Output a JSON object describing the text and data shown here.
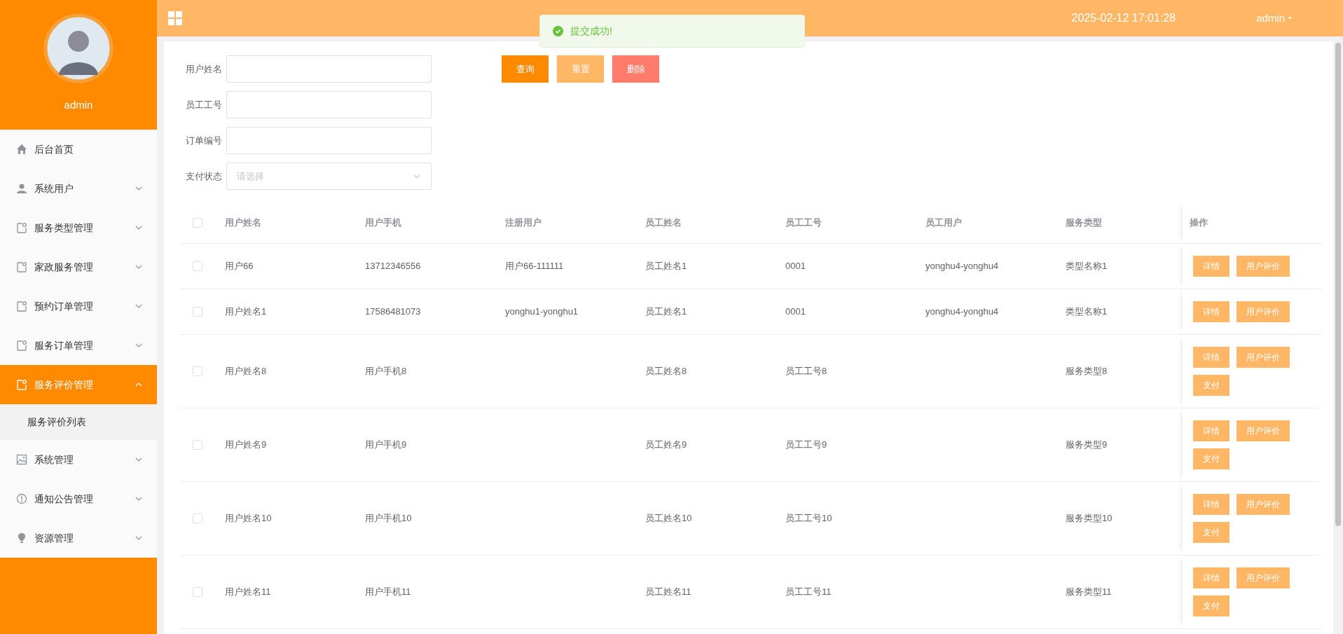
{
  "header": {
    "datetime": "2025-02-12 17:01:28",
    "user": "admin"
  },
  "toast": {
    "message": "提交成功!"
  },
  "sidebar": {
    "username": "admin",
    "items": [
      {
        "label": "后台首页",
        "kind": "home",
        "selected": false
      },
      {
        "label": "系统用户",
        "kind": "user",
        "expanded": false,
        "selected": false
      },
      {
        "label": "服务类型管理",
        "kind": "doc",
        "expanded": false,
        "selected": false
      },
      {
        "label": "家政服务管理",
        "kind": "doc",
        "expanded": false,
        "selected": false
      },
      {
        "label": "预约订单管理",
        "kind": "doc",
        "expanded": false,
        "selected": false
      },
      {
        "label": "服务订单管理",
        "kind": "doc",
        "expanded": false,
        "selected": false
      },
      {
        "label": "服务评价管理",
        "kind": "doc",
        "expanded": true,
        "selected": true,
        "children": [
          {
            "label": "服务评价列表"
          }
        ]
      },
      {
        "label": "系统管理",
        "kind": "image",
        "expanded": false,
        "selected": false
      },
      {
        "label": "通知公告管理",
        "kind": "alert",
        "expanded": false,
        "selected": false
      },
      {
        "label": "资源管理",
        "kind": "bulb",
        "expanded": false,
        "selected": false
      }
    ]
  },
  "filters": [
    {
      "label": "用户姓名",
      "kind": "text"
    },
    {
      "label": "员工工号",
      "kind": "text"
    },
    {
      "label": "订单编号",
      "kind": "text"
    },
    {
      "label": "支付状态",
      "kind": "select",
      "placeholder": "请选择"
    }
  ],
  "buttons": [
    {
      "label": "查询",
      "kind": "primary"
    },
    {
      "label": "重置",
      "kind": "secondary"
    },
    {
      "label": "删除",
      "kind": "danger"
    }
  ],
  "table": {
    "all_checked": false,
    "columns": [
      "用户姓名",
      "用户手机",
      "注册用户",
      "员工姓名",
      "员工工号",
      "员工用户",
      "服务类型",
      "操作"
    ],
    "rows": [
      {
        "checked": false,
        "cells": [
          "用户66",
          "13712346556",
          "用户66-111111",
          "员工姓名1",
          "0001",
          "yonghu4-yonghu4",
          "类型名称1"
        ],
        "actions": [
          "详情",
          "用户评价"
        ]
      },
      {
        "checked": false,
        "cells": [
          "用户姓名1",
          "17586481073",
          "yonghu1-yonghu1",
          "员工姓名1",
          "0001",
          "yonghu4-yonghu4",
          "类型名称1"
        ],
        "actions": [
          "详情",
          "用户评价"
        ]
      },
      {
        "checked": false,
        "cells": [
          "用户姓名8",
          "用户手机8",
          null,
          "员工姓名8",
          "员工工号8",
          null,
          "服务类型8"
        ],
        "actions": [
          "详情",
          "用户评价",
          "支付"
        ]
      },
      {
        "checked": false,
        "cells": [
          "用户姓名9",
          "用户手机9",
          null,
          "员工姓名9",
          "员工工号9",
          null,
          "服务类型9"
        ],
        "actions": [
          "详情",
          "用户评价",
          "支付"
        ]
      },
      {
        "checked": false,
        "cells": [
          "用户姓名10",
          "用户手机10",
          null,
          "员工姓名10",
          "员工工号10",
          null,
          "服务类型10"
        ],
        "actions": [
          "详情",
          "用户评价",
          "支付"
        ]
      },
      {
        "checked": false,
        "cells": [
          "用户姓名11",
          "用户手机11",
          null,
          "员工姓名11",
          "员工工号11",
          null,
          "服务类型11"
        ],
        "actions": [
          "详情",
          "用户评价",
          "支付"
        ]
      }
    ]
  }
}
